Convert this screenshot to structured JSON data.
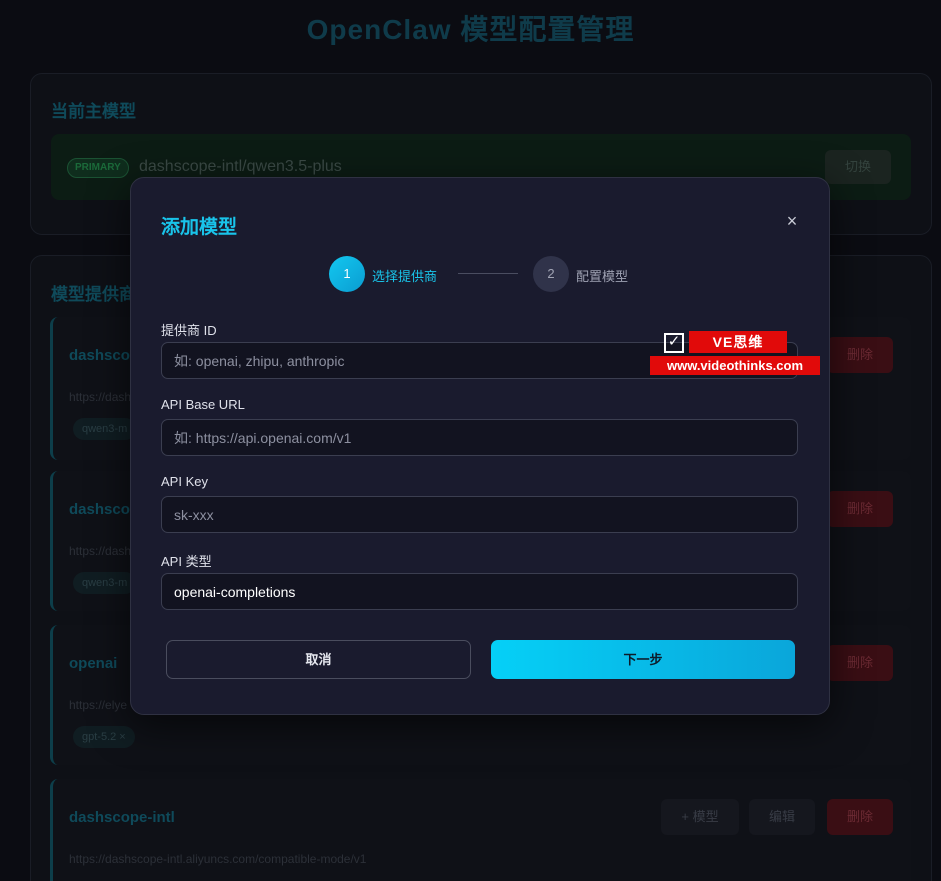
{
  "app": {
    "title": "OpenClaw 模型配置管理"
  },
  "primary_section": {
    "title": "当前主模型",
    "badge": "PRIMARY",
    "model": "dashscope-intl/qwen3.5-plus",
    "switch_label": "切换"
  },
  "providers_section": {
    "title": "模型提供商",
    "providers": [
      {
        "name": "dashscope",
        "url": "https://dash",
        "tag": "qwen3-m",
        "delete_label": "删除"
      },
      {
        "name": "dashscope",
        "url": "https://dash",
        "tag": "qwen3-m",
        "delete_label": "删除"
      },
      {
        "name": "openai",
        "url": "https://elye",
        "tag": "gpt-5.2 ×",
        "delete_label": "删除"
      },
      {
        "name": "dashscope-intl",
        "url": "https://dashscope-intl.aliyuncs.com/compatible-mode/v1",
        "add_model_label": "+ 模型",
        "edit_label": "编辑",
        "delete_label": "删除"
      }
    ]
  },
  "modal": {
    "title": "添加模型",
    "close_symbol": "×",
    "steps": [
      {
        "number": "1",
        "label": "选择提供商",
        "active": true
      },
      {
        "number": "2",
        "label": "配置模型",
        "active": false
      }
    ],
    "fields": {
      "provider_id": {
        "label": "提供商 ID",
        "placeholder": "如: openai, zhipu, anthropic",
        "value": ""
      },
      "base_url": {
        "label": "API Base URL",
        "placeholder": "如: https://api.openai.com/v1",
        "value": ""
      },
      "api_key": {
        "label": "API Key",
        "placeholder": "sk-xxx",
        "value": ""
      },
      "api_type": {
        "label": "API 类型",
        "value": "openai-completions"
      }
    },
    "cancel_label": "取消",
    "next_label": "下一步"
  },
  "watermark": {
    "brand": "VE思维",
    "url": "www.videothinks.com"
  },
  "colors": {
    "accent": "#19c4ea",
    "modal_bg": "#1a1b2e",
    "page_bg": "#0b0c12",
    "danger": "#3a0e14",
    "watermark_red": "#e10a0a"
  }
}
